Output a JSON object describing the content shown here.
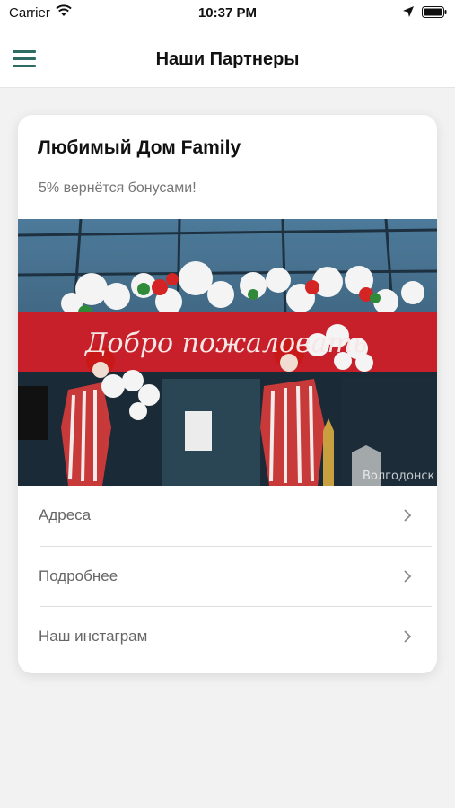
{
  "status_bar": {
    "carrier": "Carrier",
    "time": "10:37 PM",
    "icons": [
      "wifi-icon",
      "location-arrow-icon",
      "battery-icon"
    ]
  },
  "nav": {
    "title": "Наши Партнеры",
    "menu_icon": "hamburger-menu-icon",
    "accent_color": "#2e6b63"
  },
  "partner": {
    "name": "Любимый Дом Family",
    "bonus_text": "5% вернётся бонусами!",
    "photo_banner_text": "Добро пожаловать",
    "photo_watermark": "Волгодонск",
    "links": [
      {
        "label": "Адреса",
        "icon": "chevron-right-icon"
      },
      {
        "label": "Подробнее",
        "icon": "chevron-right-icon"
      },
      {
        "label": "Наш инстаграм",
        "icon": "chevron-right-icon"
      }
    ]
  },
  "colors": {
    "background": "#f2f2f2",
    "banner_red": "#c8202a",
    "secondary_text": "#777777"
  }
}
